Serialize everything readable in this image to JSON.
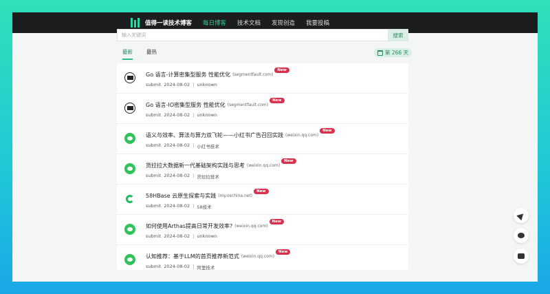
{
  "nav": {
    "brand": "值得一读技术博客",
    "items": [
      {
        "label": "每日博客",
        "active": true
      },
      {
        "label": "技术文档",
        "active": false
      },
      {
        "label": "发现创造",
        "active": false
      },
      {
        "label": "我要投稿",
        "active": false
      }
    ]
  },
  "search": {
    "placeholder": "输入关键词",
    "button": "搜索"
  },
  "tabs": [
    {
      "label": "最新",
      "active": true
    },
    {
      "label": "最热",
      "active": false
    }
  ],
  "daycount": "第 266 天",
  "items": [
    {
      "icon": "segmentfault-icon",
      "title": "Go 语言-计算密集型服务 性能优化",
      "domain": "(segmentfault.com)",
      "badge": "New",
      "submit": "submit",
      "date": "2024-08-02",
      "sep": "|",
      "author": "unknown"
    },
    {
      "icon": "segmentfault-icon",
      "title": "Go 语言-IO密集型服务 性能优化",
      "domain": "(segmentfault.com)",
      "badge": "New",
      "submit": "submit",
      "date": "2024-08-02",
      "sep": "|",
      "author": "unknown"
    },
    {
      "icon": "wechat-icon",
      "title": "语义与效率、算法与算力双飞轮——小红书广告召回实践",
      "domain": "(weixin.qq.com)",
      "badge": "New",
      "submit": "submit",
      "date": "2024-08-02",
      "sep": "|",
      "author": "小红书技术"
    },
    {
      "icon": "wechat-icon",
      "title": "货拉拉大数据新一代基础架构实践与思考",
      "domain": "(weixin.qq.com)",
      "badge": "New",
      "submit": "submit",
      "date": "2024-08-02",
      "sep": "|",
      "author": "货拉拉技术"
    },
    {
      "icon": "oschina-icon",
      "title": "58HBase 云原生探索与实践",
      "domain": "(my.oschina.net)",
      "badge": "New",
      "submit": "submit",
      "date": "2024-08-02",
      "sep": "|",
      "author": "58技术"
    },
    {
      "icon": "wechat-icon",
      "title": "如何使用Arthas提高日常开发效率?",
      "domain": "(weixin.qq.com)",
      "badge": "New",
      "submit": "submit",
      "date": "2024-08-02",
      "sep": "|",
      "author": "unknown"
    },
    {
      "icon": "wechat-icon",
      "title": "认知推荐：基于LLM的首页推荐新范式",
      "domain": "(weixin.qq.com)",
      "badge": "New",
      "submit": "submit",
      "date": "2024-08-02",
      "sep": "|",
      "author": "阿里技术"
    }
  ],
  "floating": [
    {
      "icon": "send-icon"
    },
    {
      "icon": "wechat-icon"
    },
    {
      "icon": "chat-icon"
    }
  ]
}
